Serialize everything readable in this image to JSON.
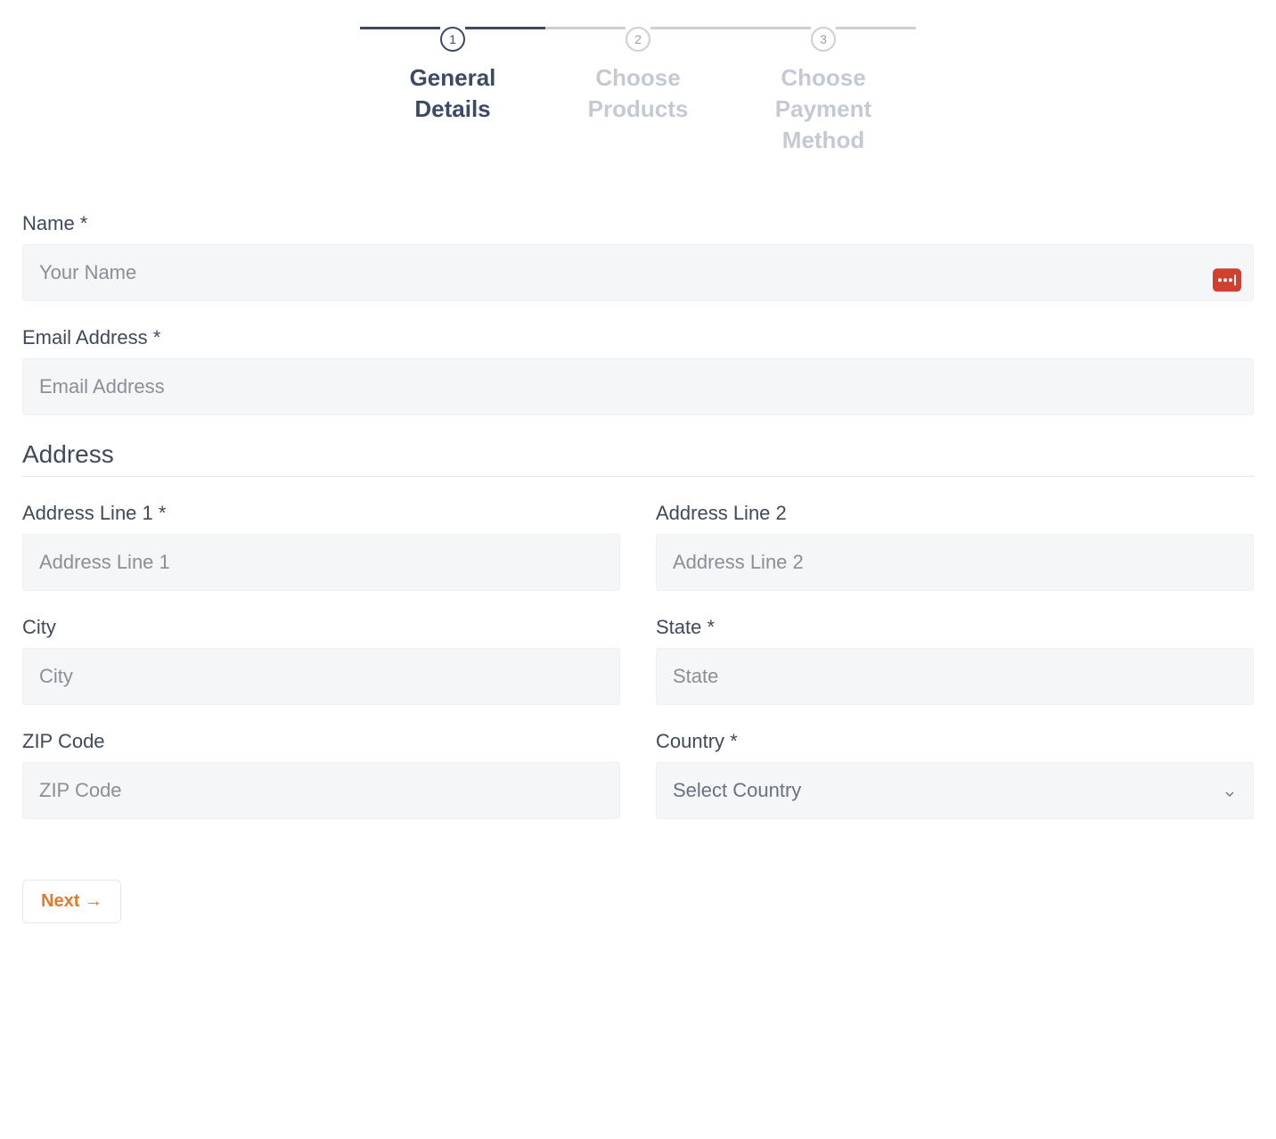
{
  "stepper": {
    "steps": [
      {
        "number": "1",
        "label": "General Details",
        "active": true
      },
      {
        "number": "2",
        "label": "Choose Products",
        "active": false
      },
      {
        "number": "3",
        "label": "Choose Payment Method",
        "active": false
      }
    ]
  },
  "form": {
    "name": {
      "label": "Name *",
      "placeholder": "Your Name"
    },
    "email": {
      "label": "Email Address *",
      "placeholder": "Email Address"
    },
    "address_section_title": "Address",
    "address1": {
      "label": "Address Line 1 *",
      "placeholder": "Address Line 1"
    },
    "address2": {
      "label": "Address Line 2",
      "placeholder": "Address Line 2"
    },
    "city": {
      "label": "City",
      "placeholder": "City"
    },
    "state": {
      "label": "State *",
      "placeholder": "State"
    },
    "zip": {
      "label": "ZIP Code",
      "placeholder": "ZIP Code"
    },
    "country": {
      "label": "Country *",
      "placeholder": "Select Country"
    }
  },
  "buttons": {
    "next": "Next →"
  }
}
